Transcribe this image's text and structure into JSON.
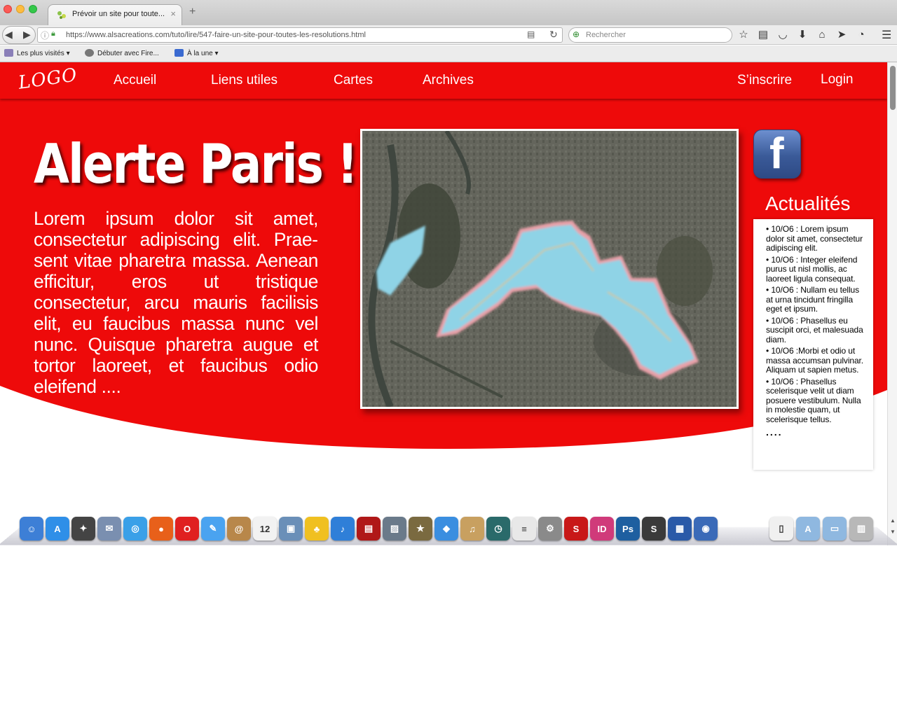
{
  "browser": {
    "tab_title": "Prévoir un site pour toute...",
    "tab_close": "×",
    "new_tab": "+",
    "url": "https://www.alsacreations.com/tuto/lire/547-faire-un-site-pour-toutes-les-resolutions.html",
    "search_placeholder": "Rechercher",
    "toolbar_icons": [
      "star-icon",
      "reading-list-icon",
      "pocket-icon",
      "download-icon",
      "home-icon",
      "share-icon",
      "sync-icon"
    ],
    "bookmarks": [
      {
        "label": "Les plus visités",
        "icon": "folder-icon",
        "dropdown": true
      },
      {
        "label": "Débuter avec Fire...",
        "icon": "globe-icon",
        "dropdown": false
      },
      {
        "label": "À la une",
        "icon": "rss-icon",
        "dropdown": true
      }
    ]
  },
  "site": {
    "logo": "LOGO",
    "nav": {
      "accueil": "Accueil",
      "liens": "Liens utiles",
      "cartes": "Cartes",
      "archives": "Archives",
      "inscrire": "S’inscrire",
      "login": "Login"
    },
    "hero_title": "Alerte Paris !",
    "hero_text": "Lorem ipsum dolor sit amet, consectetur adipiscing elit. Prae­sent vitae pharetra massa. Aenean efficitur, eros ut tristique consectetur, arcu mauris facilisis elit, eu faucibus massa nunc vel nunc. Quisque pharetra augue et tortor laoreet, et faucibus odio eleifend  ....",
    "facebook_letter": "f",
    "news_title": "Actualités",
    "news": [
      "• 10/O6 : Lorem ipsum dolor sit amet, consecte­tur adipiscing elit.",
      "• 10/O6 : Integer elei­fend purus ut nisl mollis, ac laoreet ligula conse­quat.",
      "• 10/O6 : Nullam eu tellus at urna tincidunt fringilla eget et ipsum.",
      "• 10/O6 : Phasellus eu suscipit orci, et male­suada diam.",
      "• 10/O6 :Morbi et odio ut massa accumsan pulvi­nar. Aliquam ut sapien metus.",
      "• 10/O6 : Phasellus scelerisque velit ut diam posuere vestibulum. Nulla in molestie quam, ut scelerisque tellus."
    ],
    "news_more": "....",
    "colors": {
      "brand_red": "#ee0a0a",
      "flood_blue": "#8fd3e6"
    }
  },
  "dock": {
    "icons": [
      {
        "name": "finder-icon",
        "color": "#3d7fd6",
        "glyph": "☺"
      },
      {
        "name": "app-store-icon",
        "color": "#2f8fe8",
        "glyph": "A"
      },
      {
        "name": "launchpad-icon",
        "color": "#444444",
        "glyph": "✦"
      },
      {
        "name": "mail-stamp-icon",
        "color": "#7a8fb0",
        "glyph": "✉"
      },
      {
        "name": "safari-icon",
        "color": "#3aa0e8",
        "glyph": "◎"
      },
      {
        "name": "firefox-icon",
        "color": "#e8601a",
        "glyph": "●"
      },
      {
        "name": "opera-icon",
        "color": "#e02020",
        "glyph": "O"
      },
      {
        "name": "messages-icon",
        "color": "#4aa3f0",
        "glyph": "✎"
      },
      {
        "name": "contacts-icon",
        "color": "#b8874a",
        "glyph": "@"
      },
      {
        "name": "calendar-icon",
        "color": "#f2f2f2",
        "glyph": "12"
      },
      {
        "name": "preview-icon",
        "color": "#6a8fb8",
        "glyph": "▣"
      },
      {
        "name": "cyberduck-icon",
        "color": "#f0c020",
        "glyph": "♣"
      },
      {
        "name": "itunes-icon",
        "color": "#2f7fd8",
        "glyph": "♪"
      },
      {
        "name": "photo-booth-icon",
        "color": "#b01818",
        "glyph": "▤"
      },
      {
        "name": "iphoto-icon",
        "color": "#6a7a8a",
        "glyph": "▨"
      },
      {
        "name": "imovie-icon",
        "color": "#7a6a40",
        "glyph": "★"
      },
      {
        "name": "dropbox-icon",
        "color": "#3a8ee0",
        "glyph": "◆"
      },
      {
        "name": "garageband-icon",
        "color": "#c8a060",
        "glyph": "♫"
      },
      {
        "name": "time-machine-icon",
        "color": "#2a6a6a",
        "glyph": "◷"
      },
      {
        "name": "textedit-icon",
        "color": "#e8e8e8",
        "glyph": "≡"
      },
      {
        "name": "system-preferences-icon",
        "color": "#8a8a8a",
        "glyph": "⚙"
      },
      {
        "name": "sketchbook-icon",
        "color": "#c81818",
        "glyph": "S"
      },
      {
        "name": "indesign-icon",
        "color": "#d03a7a",
        "glyph": "ID"
      },
      {
        "name": "photoshop-icon",
        "color": "#1e5fa0",
        "glyph": "Ps"
      },
      {
        "name": "sublime-text-icon",
        "color": "#3a3a3a",
        "glyph": "S"
      },
      {
        "name": "screen-sharing-icon",
        "color": "#2a5aa8",
        "glyph": "▦"
      },
      {
        "name": "globe-network-icon",
        "color": "#3a6ab8",
        "glyph": "◉"
      }
    ],
    "right_icons": [
      {
        "name": "document-icon",
        "color": "#f0f0f0",
        "glyph": "▯"
      },
      {
        "name": "applications-folder-icon",
        "color": "#8fb8e0",
        "glyph": "A"
      },
      {
        "name": "documents-folder-icon",
        "color": "#8fb8e0",
        "glyph": "▭"
      },
      {
        "name": "trash-icon",
        "color": "#b8b8b8",
        "glyph": "▥"
      }
    ]
  }
}
